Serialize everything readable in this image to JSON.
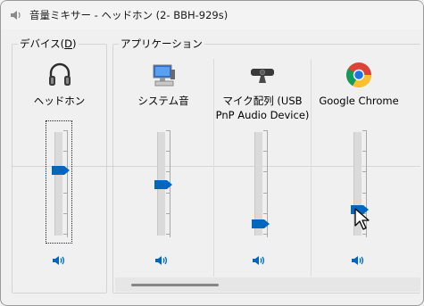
{
  "window": {
    "title": "音量ミキサー - ヘッドホン (2- BBH-929s)",
    "accent": "#0067c0"
  },
  "device_group": {
    "label": "デバイス(",
    "access_key": "D",
    "label_end": ")",
    "channels": [
      {
        "name": "ヘッドホン",
        "icon": "headphones-icon",
        "level": 0.62,
        "muted": false
      }
    ]
  },
  "app_group": {
    "label": "アプリケーション",
    "channels": [
      {
        "name": "システム音",
        "icon": "system-sounds-icon",
        "level": 0.47,
        "muted": false
      },
      {
        "name": "マイク配列 (USB\nPnP Audio Device)",
        "icon": "webcam-mic-icon",
        "level": 0.08,
        "muted": false
      },
      {
        "name": "Google Chrome",
        "icon": "chrome-icon",
        "level": 0.22,
        "muted": false
      }
    ]
  },
  "scrollbar": {
    "position": 0.0
  }
}
